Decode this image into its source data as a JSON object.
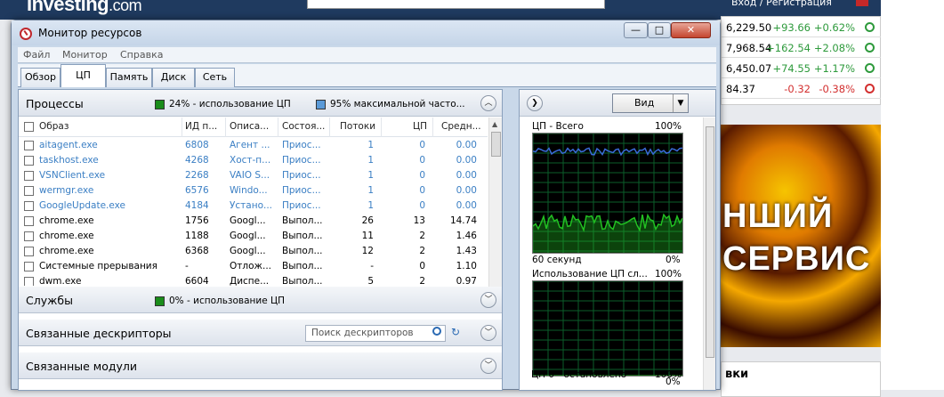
{
  "browser": {
    "logo": "Investing",
    "logo_suffix": ".com",
    "login": "Вход / Регистрация",
    "quotes": [
      {
        "price": "6,229.50",
        "change": "+93.66",
        "pct": "+0.62%",
        "color": "#2e9a3c",
        "icon": "clock-icon"
      },
      {
        "price": "7,968.54",
        "change": "+162.54",
        "pct": "+2.08%",
        "color": "#2e9a3c",
        "icon": "clock-icon"
      },
      {
        "price": "6,450.07",
        "change": "+74.55",
        "pct": "+1.17%",
        "color": "#2e9a3c",
        "icon": "clock-icon"
      },
      {
        "price": "84.37",
        "change": "-0.32",
        "pct": "-0.38%",
        "color": "#d32f2f",
        "icon": "clock-icon"
      }
    ],
    "ad_line1": "НШИЙ",
    "ad_line2": "СЕРВИС",
    "news_heading": "вки"
  },
  "window": {
    "title": "Монитор ресурсов",
    "controls": {
      "minimize": "—",
      "maximize": "□",
      "close": "✕"
    }
  },
  "menu": [
    "Файл",
    "Монитор",
    "Справка"
  ],
  "tabs": [
    {
      "label": "Обзор",
      "active": false
    },
    {
      "label": "ЦП",
      "active": true
    },
    {
      "label": "Память",
      "active": false
    },
    {
      "label": "Диск",
      "active": false
    },
    {
      "label": "Сеть",
      "active": false
    }
  ],
  "processes": {
    "title": "Процессы",
    "legend1": "24% - использование ЦП",
    "legend1_color": "#1a8c1a",
    "legend2": "95% максимальной часто...",
    "legend2_color": "#5a9ad8",
    "columns": {
      "image": "Образ",
      "pid": "ИД п...",
      "desc": "Описа...",
      "state": "Состоя...",
      "threads": "Потоки",
      "cpu": "ЦП",
      "avg": "Средн..."
    },
    "rows": [
      {
        "image": "aitagent.exe",
        "pid": "6808",
        "desc": "Агент ...",
        "state": "Приос...",
        "threads": "1",
        "cpu": "0",
        "avg": "0.00",
        "suspended": true
      },
      {
        "image": "taskhost.exe",
        "pid": "4268",
        "desc": "Хост-п...",
        "state": "Приос...",
        "threads": "1",
        "cpu": "0",
        "avg": "0.00",
        "suspended": true
      },
      {
        "image": "VSNClient.exe",
        "pid": "2268",
        "desc": "VAIO S...",
        "state": "Приос...",
        "threads": "1",
        "cpu": "0",
        "avg": "0.00",
        "suspended": true
      },
      {
        "image": "wermgr.exe",
        "pid": "6576",
        "desc": "Windo...",
        "state": "Приос...",
        "threads": "1",
        "cpu": "0",
        "avg": "0.00",
        "suspended": true
      },
      {
        "image": "GoogleUpdate.exe",
        "pid": "4184",
        "desc": "Устано...",
        "state": "Приос...",
        "threads": "1",
        "cpu": "0",
        "avg": "0.00",
        "suspended": true
      },
      {
        "image": "chrome.exe",
        "pid": "1756",
        "desc": "Googl...",
        "state": "Выпол...",
        "threads": "26",
        "cpu": "13",
        "avg": "14.74",
        "suspended": false
      },
      {
        "image": "chrome.exe",
        "pid": "1188",
        "desc": "Googl...",
        "state": "Выпол...",
        "threads": "11",
        "cpu": "2",
        "avg": "1.46",
        "suspended": false
      },
      {
        "image": "chrome.exe",
        "pid": "6368",
        "desc": "Googl...",
        "state": "Выпол...",
        "threads": "12",
        "cpu": "2",
        "avg": "1.43",
        "suspended": false
      },
      {
        "image": "Системные прерывания",
        "pid": "-",
        "desc": "Отлож...",
        "state": "Выпол...",
        "threads": "-",
        "cpu": "0",
        "avg": "1.10",
        "suspended": false
      },
      {
        "image": "dwm.exe",
        "pid": "6604",
        "desc": "Диспе...",
        "state": "Выпол...",
        "threads": "5",
        "cpu": "2",
        "avg": "0.97",
        "suspended": false
      }
    ]
  },
  "services": {
    "title": "Службы",
    "legend": "0% - использование ЦП",
    "legend_color": "#1a8c1a"
  },
  "handles": {
    "title": "Связанные дескрипторы",
    "search_placeholder": "Поиск дескрипторов"
  },
  "modules": {
    "title": "Связанные модули"
  },
  "graphs_panel": {
    "view_label": "Вид",
    "graph1_title": "ЦП - Всего",
    "graph1_max": "100%",
    "graph1_time": "60 секунд",
    "graph1_min": "0%",
    "graph2_title": "Использование ЦП сл...",
    "graph2_max": "100%",
    "graph2_min": "0%",
    "graph3_title": "ЦП 0 - остановлено",
    "graph3_max": "100%",
    "line_blue": "#3a6bd8",
    "line_green": "#22c022",
    "grid_color": "#0b5e2a"
  }
}
